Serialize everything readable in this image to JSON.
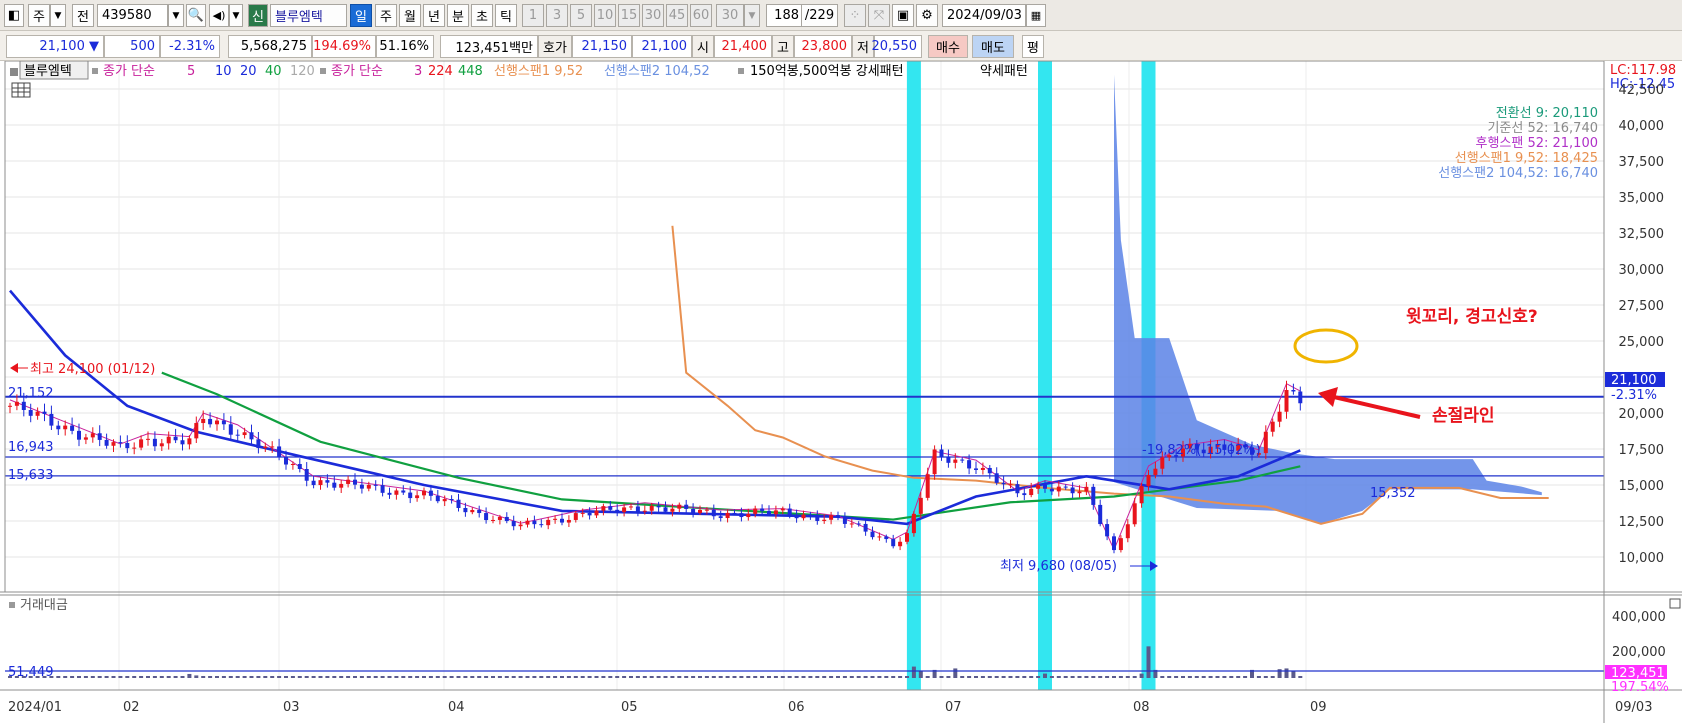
{
  "colors": {
    "accent": "#1a6bd6",
    "up": "#e8141c",
    "down": "#1b2bd9",
    "highlight": "#33e6f0",
    "cloud": "#5a82e6"
  },
  "toolbar": {
    "market": "주",
    "prev": "전",
    "code": "439580",
    "sin": "신",
    "name": "블루엠텍",
    "periods": [
      "일",
      "주",
      "월",
      "년",
      "분",
      "초",
      "틱"
    ],
    "minutes": [
      "1",
      "3",
      "5",
      "10",
      "15",
      "30",
      "45",
      "60"
    ],
    "minute_select": "30",
    "count_value": "188",
    "count_total": "/229",
    "date": "2024/09/03"
  },
  "quote": {
    "price": "21,100",
    "change": "500",
    "change_pct": "-2.31%",
    "volume": "5,568,275",
    "volume_ratio": "194.69%",
    "turnover_rate": "51.16%",
    "amount": "123,451백만",
    "hoga_label": "호가",
    "ask": "21,150",
    "bid": "21,100",
    "open_label": "시",
    "open": "21,400",
    "high_label": "고",
    "high": "23,800",
    "low_label": "저",
    "low": "20,550",
    "buy_label": "매수",
    "sell_label": "매도",
    "eval_label": "평"
  },
  "legend": {
    "name": "블루엠텍",
    "ma_label": "종가 단순",
    "ma_periods": [
      "5",
      "10",
      "20",
      "40",
      "120"
    ],
    "vma_label": "종가 단순",
    "vma_periods": [
      "3",
      "224",
      "448"
    ],
    "span1": "선행스팬1 9,52",
    "span2": "선행스팬2 104,52",
    "pattern": "150억봉,500억봉 강세패턴",
    "weak": "약세패턴"
  },
  "lc_hc": {
    "lc": "LC:117.98",
    "hc": "HC:-12.45"
  },
  "ichimoku": [
    {
      "text": "전환선 9: 20,110",
      "color": "#1a9a7a"
    },
    {
      "text": "기준선 52: 16,740",
      "color": "#8a8a8a"
    },
    {
      "text": "후행스팬 52: 21,100",
      "color": "#b030c8"
    },
    {
      "text": "선행스팬1 9,52: 18,425",
      "color": "#e89050"
    },
    {
      "text": "선행스팬2 104,52: 16,740",
      "color": "#6a90e0"
    }
  ],
  "price_axis": [
    "42,500",
    "40,000",
    "37,500",
    "35,000",
    "32,500",
    "30,000",
    "27,500",
    "25,000",
    "22,500",
    "20,000",
    "17,500",
    "15,000",
    "12,500",
    "10,000"
  ],
  "current_price_tag": "21,100",
  "current_change_tag": "-2.31%",
  "annotations": {
    "high": "최고 24,100 (01/12)",
    "low": "최저 9,680 (08/05)",
    "level_21152": "21,152",
    "level_16943": "16,943",
    "level_15633": "15,633",
    "level_15352": "15,352",
    "cloud_pct": "-19,82%(-15,02%)",
    "warning": "윗꼬리, 경고신호?",
    "stoploss": "손절라인"
  },
  "volume_panel": {
    "title": "거래대금",
    "axis": [
      "400,000",
      "200,000"
    ],
    "level": "51,449",
    "tag_value": "123,451",
    "tag_pct": "197.54%"
  },
  "time_axis": [
    "2024/01",
    "02",
    "03",
    "04",
    "05",
    "06",
    "07",
    "08",
    "09"
  ],
  "right_date": "09/03",
  "chart_data": {
    "type": "candlestick",
    "ylim": [
      9000,
      44000
    ],
    "y_ticks": [
      10000,
      12500,
      15000,
      17500,
      20000,
      22500,
      25000,
      27500,
      30000,
      32500,
      35000,
      37500,
      40000,
      42500
    ],
    "hlines": [
      21152,
      16943,
      15633,
      21100
    ],
    "anchors": [
      {
        "x": 0,
        "price": 20500
      },
      {
        "x": 8,
        "price": 19000
      },
      {
        "x": 16,
        "price": 17500
      },
      {
        "x": 20,
        "price": 18200
      },
      {
        "x": 26,
        "price": 18000
      },
      {
        "x": 28,
        "price": 19600
      },
      {
        "x": 33,
        "price": 18800
      },
      {
        "x": 44,
        "price": 15300
      },
      {
        "x": 60,
        "price": 14300
      },
      {
        "x": 74,
        "price": 12100
      },
      {
        "x": 83,
        "price": 13000
      },
      {
        "x": 92,
        "price": 13500
      },
      {
        "x": 103,
        "price": 13000
      },
      {
        "x": 112,
        "price": 13100
      },
      {
        "x": 120,
        "price": 12600
      },
      {
        "x": 128,
        "price": 11000
      },
      {
        "x": 130,
        "price": 11500
      },
      {
        "x": 134,
        "price": 17000
      },
      {
        "x": 140,
        "price": 16400
      },
      {
        "x": 146,
        "price": 14300
      },
      {
        "x": 150,
        "price": 15000
      },
      {
        "x": 156,
        "price": 14500
      },
      {
        "x": 160,
        "price": 10300
      },
      {
        "x": 165,
        "price": 16000
      },
      {
        "x": 170,
        "price": 17400
      },
      {
        "x": 176,
        "price": 17800
      },
      {
        "x": 181,
        "price": 17100
      },
      {
        "x": 185,
        "price": 21600
      },
      {
        "x": 187,
        "price": 21100
      }
    ],
    "volume_spikes": [
      {
        "x": 26,
        "value": 55000
      },
      {
        "x": 27,
        "value": 35000
      },
      {
        "x": 131,
        "value": 155000
      },
      {
        "x": 132,
        "value": 90000
      },
      {
        "x": 134,
        "value": 110000
      },
      {
        "x": 137,
        "value": 130000
      },
      {
        "x": 150,
        "value": 60000
      },
      {
        "x": 164,
        "value": 60000
      },
      {
        "x": 165,
        "value": 430000
      },
      {
        "x": 166,
        "value": 110000
      },
      {
        "x": 180,
        "value": 110000
      },
      {
        "x": 184,
        "value": 120000
      },
      {
        "x": 185,
        "value": 130000
      },
      {
        "x": 186,
        "value": 90000
      },
      {
        "x": 188,
        "value": 80000
      }
    ],
    "highlight_days": [
      131,
      150,
      165
    ],
    "ma_thick": [
      {
        "x": 0,
        "price": 28500
      },
      {
        "x": 8,
        "price": 24000
      },
      {
        "x": 17,
        "price": 20500
      },
      {
        "x": 27,
        "price": 18700
      },
      {
        "x": 42,
        "price": 17000
      },
      {
        "x": 60,
        "price": 15000
      },
      {
        "x": 80,
        "price": 13200
      },
      {
        "x": 100,
        "price": 13000
      },
      {
        "x": 120,
        "price": 12800
      },
      {
        "x": 130,
        "price": 12300
      },
      {
        "x": 140,
        "price": 14200
      },
      {
        "x": 156,
        "price": 15600
      },
      {
        "x": 168,
        "price": 14700
      },
      {
        "x": 178,
        "price": 15600
      },
      {
        "x": 187,
        "price": 17400
      }
    ],
    "ma_green": [
      {
        "x": 22,
        "price": 22800
      },
      {
        "x": 30,
        "price": 21300
      },
      {
        "x": 45,
        "price": 18000
      },
      {
        "x": 65,
        "price": 15500
      },
      {
        "x": 80,
        "price": 14000
      },
      {
        "x": 100,
        "price": 13400
      },
      {
        "x": 128,
        "price": 12600
      },
      {
        "x": 145,
        "price": 13800
      },
      {
        "x": 160,
        "price": 14200
      },
      {
        "x": 178,
        "price": 15300
      },
      {
        "x": 187,
        "price": 16300
      }
    ],
    "span1_orange": [
      {
        "x": 96,
        "price": 33000
      },
      {
        "x": 98,
        "price": 22800
      },
      {
        "x": 104,
        "price": 20500
      },
      {
        "x": 108,
        "price": 18800
      },
      {
        "x": 112,
        "price": 18300
      },
      {
        "x": 118,
        "price": 17000
      },
      {
        "x": 125,
        "price": 16000
      },
      {
        "x": 131,
        "price": 15500
      },
      {
        "x": 140,
        "price": 15300
      },
      {
        "x": 150,
        "price": 14800
      },
      {
        "x": 160,
        "price": 14400
      },
      {
        "x": 168,
        "price": 14200
      },
      {
        "x": 176,
        "price": 13700
      },
      {
        "x": 182,
        "price": 13500
      },
      {
        "x": 190,
        "price": 12300
      },
      {
        "x": 196,
        "price": 13000
      },
      {
        "x": 200,
        "price": 14800
      },
      {
        "x": 210,
        "price": 14800
      },
      {
        "x": 216,
        "price": 14100
      },
      {
        "x": 223,
        "price": 14100
      }
    ],
    "cloud_upper": [
      {
        "x": 160,
        "price": 43500
      },
      {
        "x": 161,
        "price": 32000
      },
      {
        "x": 163,
        "price": 25200
      },
      {
        "x": 168,
        "price": 25200
      },
      {
        "x": 172,
        "price": 19500
      },
      {
        "x": 180,
        "price": 17800
      },
      {
        "x": 186,
        "price": 17200
      },
      {
        "x": 192,
        "price": 16800
      },
      {
        "x": 212,
        "price": 16800
      },
      {
        "x": 214,
        "price": 15300
      },
      {
        "x": 219,
        "price": 14900
      },
      {
        "x": 222,
        "price": 14500
      }
    ],
    "cloud_lower": [
      {
        "x": 160,
        "price": 15200
      },
      {
        "x": 172,
        "price": 13400
      },
      {
        "x": 184,
        "price": 13200
      },
      {
        "x": 190,
        "price": 12300
      },
      {
        "x": 196,
        "price": 13200
      },
      {
        "x": 200,
        "price": 14700
      },
      {
        "x": 212,
        "price": 14700
      },
      {
        "x": 222,
        "price": 14300
      }
    ]
  }
}
